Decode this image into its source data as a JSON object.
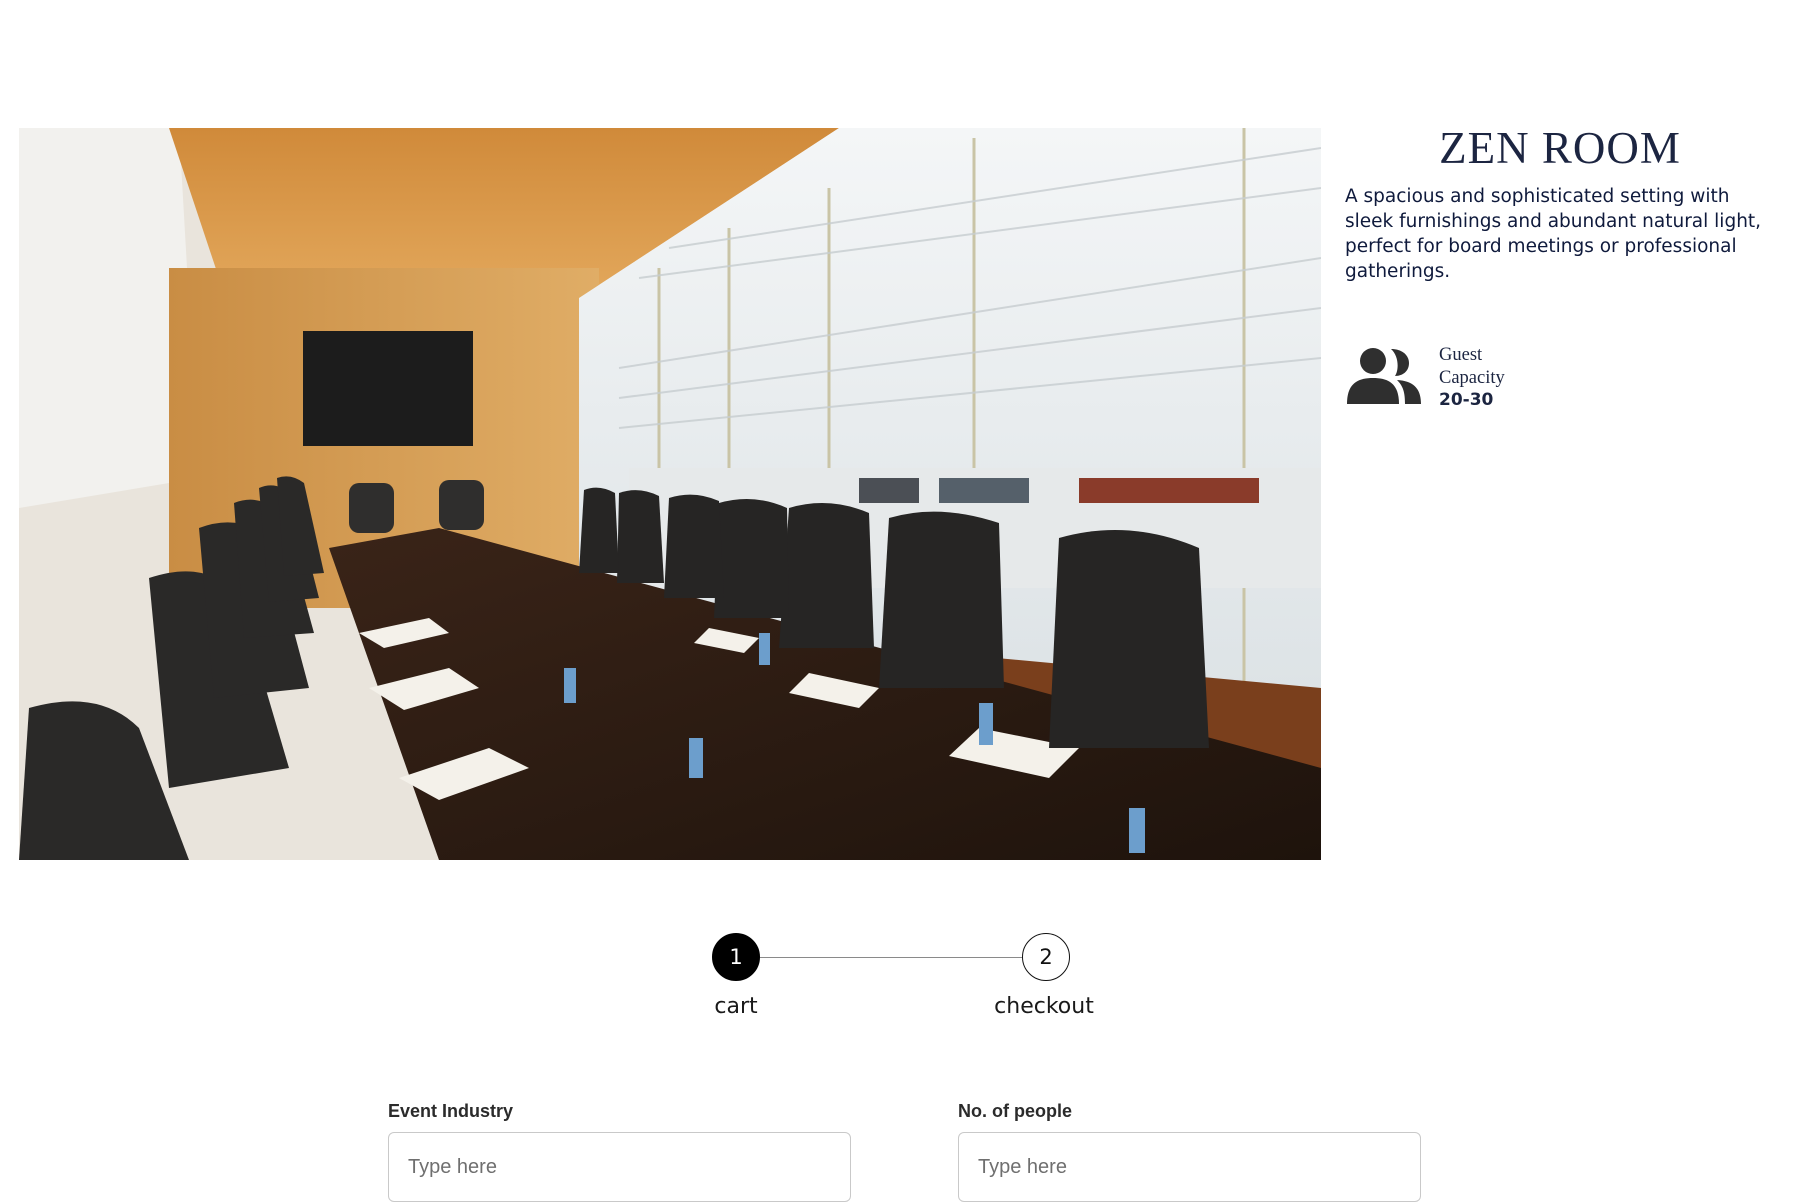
{
  "room": {
    "title": "ZEN ROOM",
    "description": "A spacious and sophisticated setting with sleek furnishings and abundant natural light, perfect for board meetings or professional gatherings.",
    "guest_icon": "people-icon",
    "guest_label": "Guest Capacity",
    "guest_value": "20-30"
  },
  "stepper": {
    "steps": [
      {
        "number": "1",
        "label": "cart",
        "active": true
      },
      {
        "number": "2",
        "label": "checkout",
        "active": false
      }
    ]
  },
  "form": {
    "event_industry": {
      "label": "Event Industry",
      "placeholder": "Type here",
      "value": ""
    },
    "no_of_people": {
      "label": "No. of people",
      "placeholder": "Type here",
      "value": ""
    }
  },
  "colors": {
    "title": "#1c2541",
    "active_step": "#000000",
    "input_border": "#c9c9c9"
  }
}
